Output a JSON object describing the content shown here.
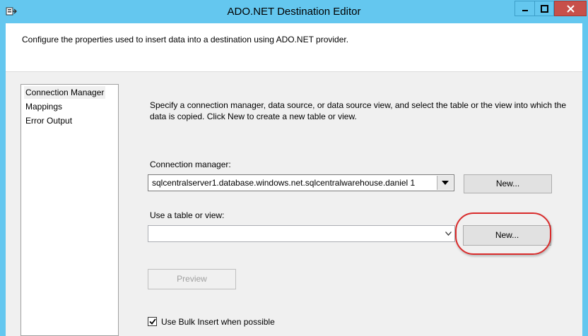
{
  "window": {
    "title": "ADO.NET Destination Editor",
    "app_icon": "ssis-destination-icon",
    "controls": [
      "minimize-icon",
      "maximize-icon",
      "close-icon"
    ]
  },
  "header": {
    "description": "Configure the properties used to insert data into a destination using ADO.NET provider."
  },
  "nav": {
    "items": [
      {
        "label": "Connection Manager",
        "selected": true
      },
      {
        "label": "Mappings",
        "selected": false
      },
      {
        "label": "Error Output",
        "selected": false
      }
    ]
  },
  "main": {
    "instructions": "Specify a connection manager, data source, or data source view, and select the table or the view into which the data is copied. Click New to create a new table or view.",
    "connection_manager": {
      "label": "Connection manager:",
      "value": "sqlcentralserver1.database.windows.net.sqlcentralwarehouse.daniel 1",
      "new_button": "New..."
    },
    "table_or_view": {
      "label": "Use a table or view:",
      "value": "",
      "new_button": "New..."
    },
    "preview_button": "Preview",
    "bulk_insert": {
      "label": "Use Bulk Insert when possible",
      "checked": true
    }
  },
  "colors": {
    "titlebar": "#64c7ef",
    "close_button": "#c7504a",
    "highlight_ring": "#d92b2b"
  }
}
